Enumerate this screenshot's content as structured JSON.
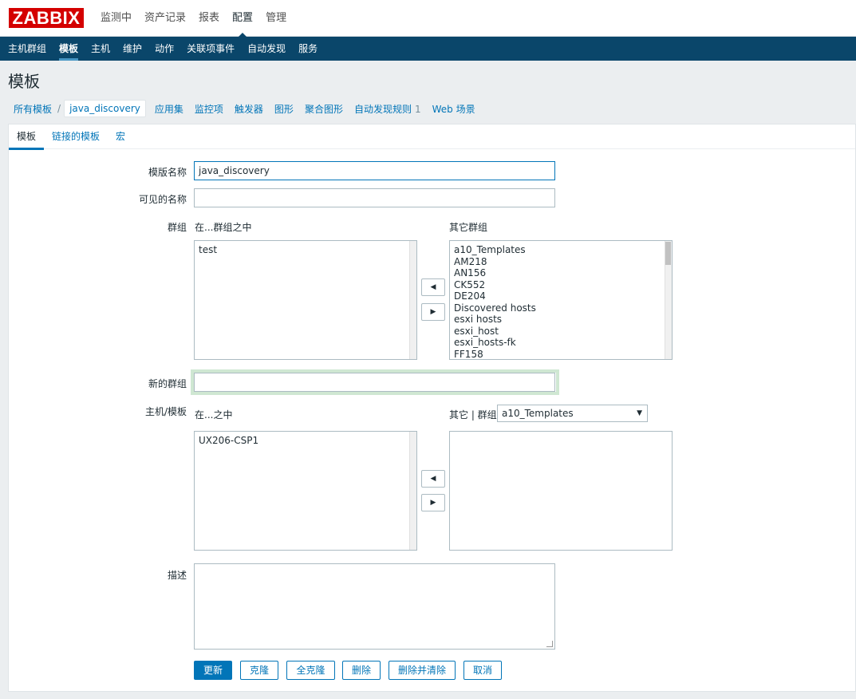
{
  "logo": "ZABBIX",
  "top_menu": [
    "监测中",
    "资产记录",
    "报表",
    "配置",
    "管理"
  ],
  "sub_menu": [
    "主机群组",
    "模板",
    "主机",
    "维护",
    "动作",
    "关联项事件",
    "自动发现",
    "服务"
  ],
  "page_title": "模板",
  "breadcrumb": {
    "all_templates": "所有模板",
    "separator": "/",
    "current": "java_discovery",
    "links": [
      "应用集",
      "监控项",
      "触发器",
      "图形",
      "聚合图形",
      "自动发现规则",
      "Web 场景"
    ],
    "discovery_count": "1"
  },
  "tabs": [
    "模板",
    "链接的模板",
    "宏"
  ],
  "form": {
    "template_name_label": "模版名称",
    "template_name_value": "java_discovery",
    "visible_name_label": "可见的名称",
    "visible_name_value": "",
    "groups_label": "群组",
    "in_groups_label": "在...群组之中",
    "other_groups_label": "其它群组",
    "in_groups": [
      "test"
    ],
    "other_groups": [
      "a10_Templates",
      "AM218",
      "AN156",
      "CK552",
      "DE204",
      "Discovered hosts",
      "esxi hosts",
      "esxi_host",
      "esxi_hosts-fk",
      "FF158"
    ],
    "new_group_label": "新的群组",
    "new_group_value": "",
    "hosts_label": "主机/模板",
    "in_hosts_label": "在...之中",
    "other_hosts_label": "其它 | 群组",
    "other_hosts_group_select": "a10_Templates",
    "in_hosts": [
      "UX206-CSP1"
    ],
    "other_hosts": [],
    "description_label": "描述",
    "description_value": ""
  },
  "buttons": {
    "update": "更新",
    "clone": "克隆",
    "full_clone": "全克隆",
    "delete": "删除",
    "delete_clear": "删除并清除",
    "cancel": "取消"
  },
  "colors": {
    "brand": "#d40000",
    "nav": "#0a466a",
    "link": "#0275b8"
  }
}
